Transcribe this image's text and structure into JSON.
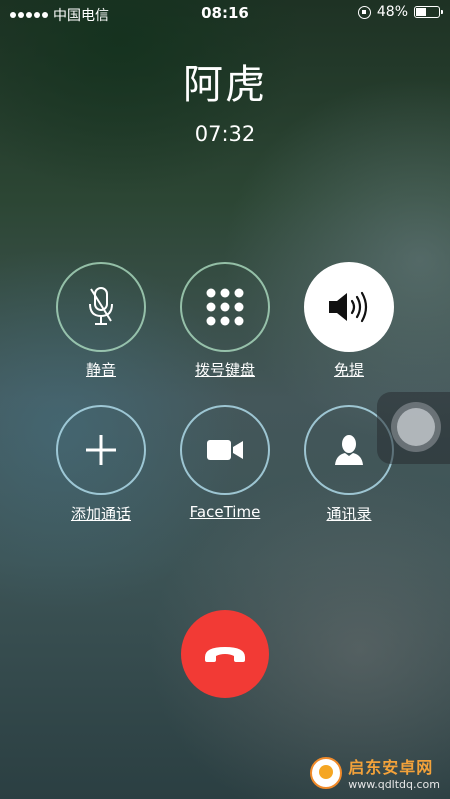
{
  "status_bar": {
    "carrier": "中国电信",
    "time": "08:16",
    "battery_percent": "48%",
    "battery_level": 0.48
  },
  "call": {
    "contact_name": "阿虎",
    "duration": "07:32"
  },
  "controls": {
    "mute": {
      "label": "静音",
      "icon": "microphone-off-icon"
    },
    "keypad": {
      "label": "拨号键盘",
      "icon": "keypad-icon"
    },
    "speaker": {
      "label": "免提",
      "icon": "speaker-icon",
      "active": true
    },
    "add_call": {
      "label": "添加通话",
      "icon": "plus-icon"
    },
    "facetime": {
      "label": "FaceTime",
      "icon": "video-camera-icon"
    },
    "contacts": {
      "label": "通讯录",
      "icon": "person-icon"
    }
  },
  "end_call": {
    "icon": "phone-hangup-icon",
    "color": "#f23a35"
  },
  "watermark": {
    "title": "启东安卓网",
    "url": "www.qdltdq.com"
  }
}
